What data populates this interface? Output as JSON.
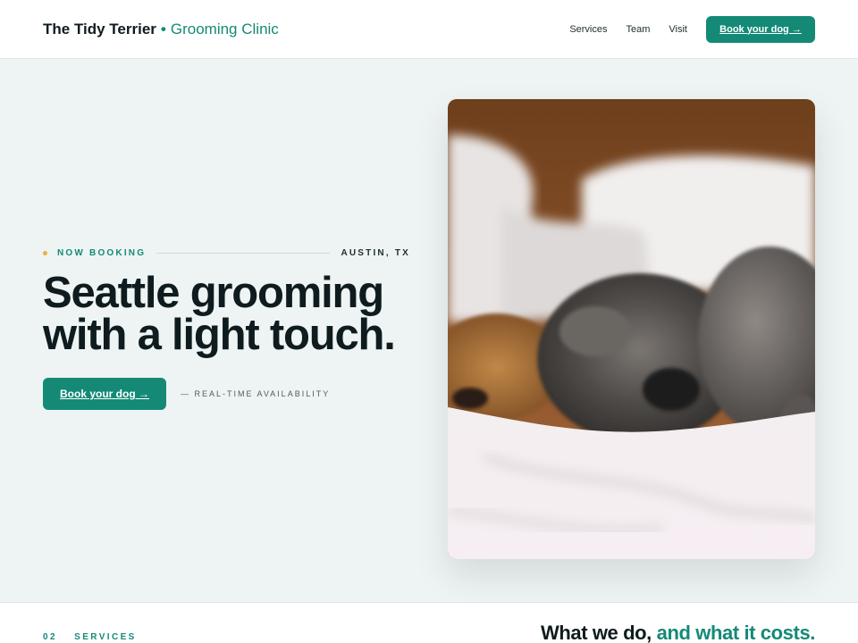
{
  "header": {
    "brand_name": "The Tidy Terrier",
    "brand_separator": "•",
    "brand_subtitle": "Grooming Clinic",
    "nav": [
      {
        "label": "Services"
      },
      {
        "label": "Team"
      },
      {
        "label": "Visit"
      }
    ],
    "cta_label": "Book your dog →"
  },
  "hero": {
    "eyebrow_label": "NOW BOOKING",
    "eyebrow_location": "AUSTIN, TX",
    "headline_line1": "Seattle grooming",
    "headline_line2": "with a light touch.",
    "cta_label": "Book your dog →",
    "availability": "— REAL-TIME AVAILABILITY",
    "image_icon": "photo-of-sleeping-dogs"
  },
  "services_section": {
    "number": "02",
    "label": "SERVICES",
    "title_part1": "What we do,",
    "title_part2": "and what it costs."
  },
  "colors": {
    "accent": "#148a76",
    "accent_dot": "#e9b13b",
    "background": "#eef4f3",
    "text": "#0f1c1f"
  }
}
